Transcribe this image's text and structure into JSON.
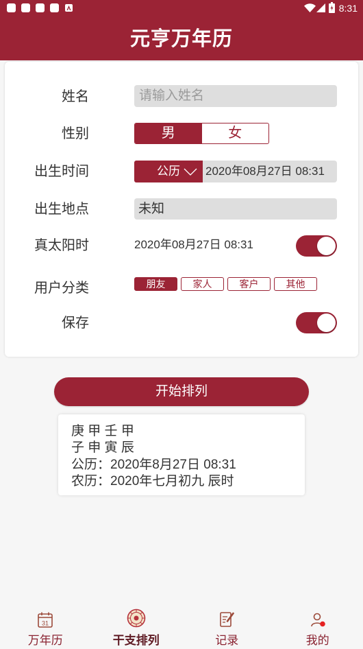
{
  "theme": {
    "accent": "#9b2335",
    "field_bg": "#dedede",
    "page_bg": "#f6f6f6",
    "nav_icon": "#9c4a3a",
    "nav_label": "#8a2331"
  },
  "status_bar": {
    "time": "8:31",
    "left_icons": [
      "notification-icon",
      "notification-icon",
      "notification-icon",
      "notification-icon",
      "app-notification-icon"
    ],
    "right_icons": [
      "wifi-icon",
      "signal-icon",
      "battery-icon"
    ]
  },
  "header": {
    "title": "元亨万年历"
  },
  "form": {
    "name": {
      "label": "姓名",
      "placeholder": "请输入姓名"
    },
    "gender": {
      "label": "性别",
      "options": [
        "男",
        "女"
      ],
      "selected_index": 0
    },
    "birth_time": {
      "label": "出生时间",
      "calendar_type": "公历",
      "calendar_icon": "chevron-down-icon",
      "value": "2020年08月27日 08:31"
    },
    "birth_place": {
      "label": "出生地点",
      "value": "未知"
    },
    "true_solar_time": {
      "label": "真太阳时",
      "value": "2020年08月27日 08:31",
      "enabled": true
    },
    "user_category": {
      "label": "用户分类",
      "options": [
        "朋友",
        "家人",
        "客户",
        "其他"
      ],
      "selected_index": 0
    },
    "save": {
      "label": "保存",
      "enabled": true
    }
  },
  "start_button": {
    "label": "开始排列"
  },
  "result": {
    "stems": "庚 甲 壬 甲",
    "branches": "子 申 寅 辰",
    "solar_date": "公历：2020年8月27日 08:31",
    "lunar_date": "农历：2020年七月初九 辰时"
  },
  "bottom_nav": {
    "active_index": 1,
    "items": [
      {
        "label": "万年历",
        "icon": "calendar-icon",
        "icon_text": "31"
      },
      {
        "label": "干支排列",
        "icon": "seal-icon"
      },
      {
        "label": "记录",
        "icon": "note-edit-icon"
      },
      {
        "label": "我的",
        "icon": "user-icon",
        "badge": true
      }
    ]
  }
}
